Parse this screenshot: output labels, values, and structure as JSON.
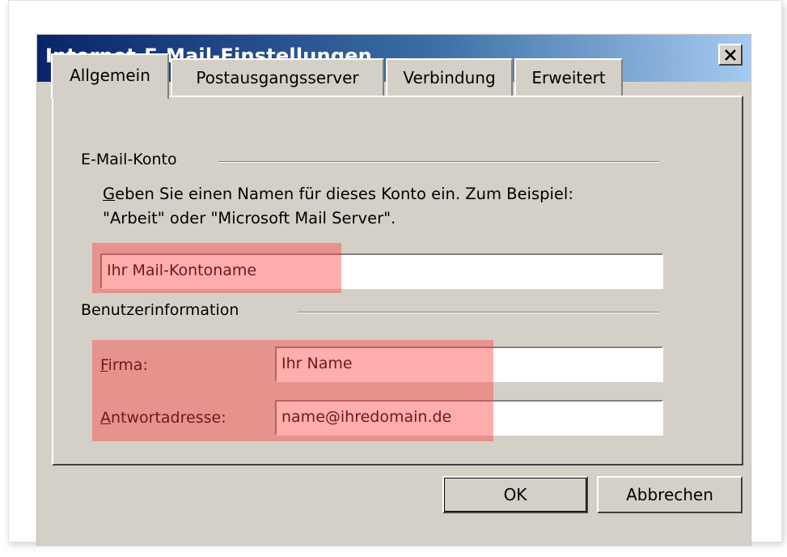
{
  "window": {
    "title": "Internet-E-Mail-Einstellungen",
    "close_glyph": "×"
  },
  "tabs": [
    {
      "label": "Allgemein",
      "active": true
    },
    {
      "label": "Postausgangsserver",
      "active": false
    },
    {
      "label": "Verbindung",
      "active": false
    },
    {
      "label": "Erweitert",
      "active": false
    }
  ],
  "account_group": {
    "title": "E-Mail-Konto",
    "description_line1_mnemonic": "G",
    "description_line1_rest": "eben Sie einen Namen für dieses Konto ein. Zum Beispiel:",
    "description_line2": "\"Arbeit\" oder \"Microsoft Mail Server\".",
    "account_name_value": "Ihr Mail-Kontoname"
  },
  "user_group": {
    "title": "Benutzerinformation",
    "company_label_mnemonic": "F",
    "company_label_rest": "irma:",
    "company_value": "Ihr Name",
    "reply_label_mnemonic": "A",
    "reply_label_rest": "ntwortadresse:",
    "reply_value": "name@ihredomain.de"
  },
  "buttons": {
    "ok_label": "OK",
    "cancel_label": "Abbrechen"
  },
  "colors": {
    "dialog_bg": "#d4d0c8",
    "title_gradient_start": "#0a246a",
    "title_gradient_end": "#a6caf0",
    "highlight": "#ff3b3b"
  }
}
